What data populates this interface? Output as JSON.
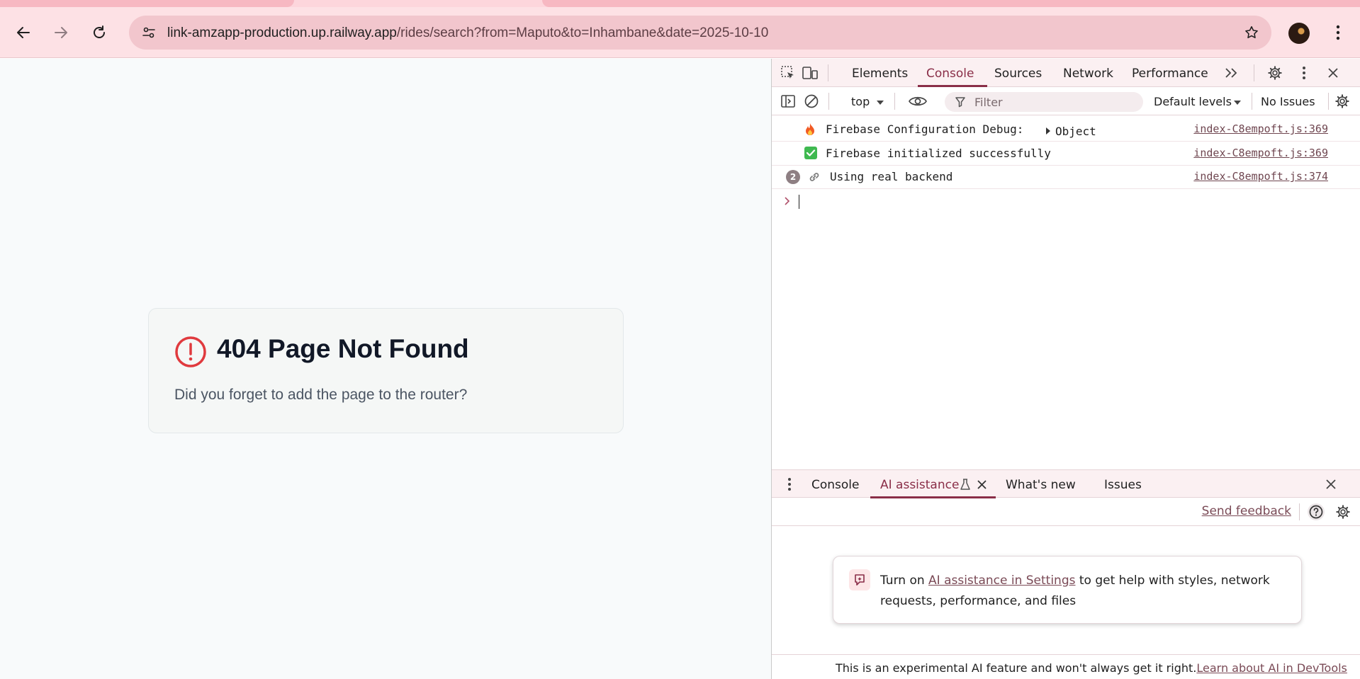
{
  "browser": {
    "url_host": "link-amzapp-production.up.railway.app",
    "url_path": "/rides/search?from=Maputo&to=Inhambane&date=2025-10-10"
  },
  "page": {
    "title": "404 Page Not Found",
    "message": "Did you forget to add the page to the router?"
  },
  "devtools": {
    "tabs": [
      "Elements",
      "Console",
      "Sources",
      "Network",
      "Performance"
    ],
    "active_tab": "Console",
    "context": "top",
    "filter_placeholder": "Filter",
    "levels": "Default levels",
    "issues": "No Issues",
    "logs": [
      {
        "message": "Firebase Configuration Debug:",
        "object": "Object",
        "source": "index-C8empoft.js:369"
      },
      {
        "message": "Firebase initialized successfully",
        "source": "index-C8empoft.js:369"
      },
      {
        "count": "2",
        "message": "Using real backend",
        "source": "index-C8empoft.js:374"
      }
    ],
    "drawer": {
      "tabs": [
        "Console",
        "AI assistance",
        "What's new",
        "Issues"
      ],
      "active_tab": "AI assistance",
      "send_feedback": "Send feedback",
      "ai_card": {
        "prefix": "Turn on ",
        "link": "AI assistance in Settings",
        "suffix": " to get help with styles, network requests, performance, and files"
      },
      "footer": {
        "text": "This is an experimental AI feature and won't always get it right.",
        "link": "Learn about AI in DevTools"
      }
    }
  },
  "colors": {
    "accent": "#8a2e48",
    "error": "#e03a3e"
  }
}
